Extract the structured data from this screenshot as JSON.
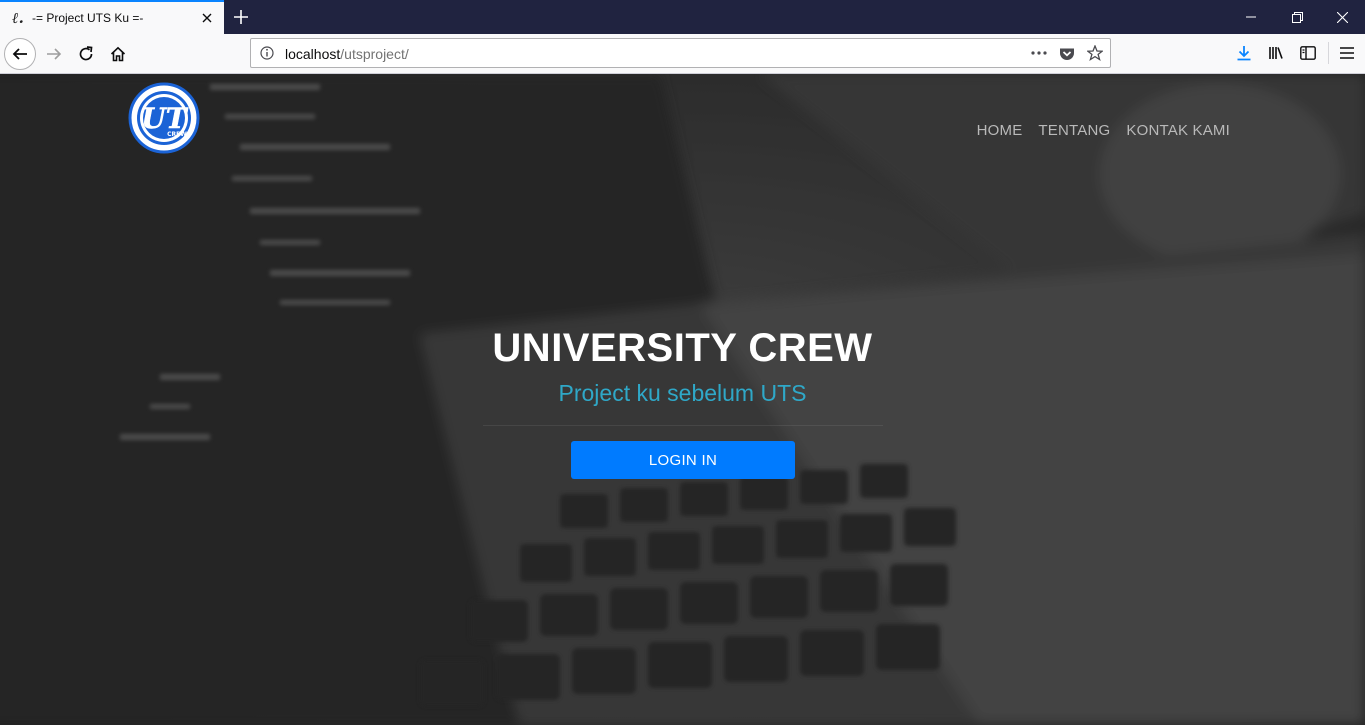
{
  "browser": {
    "tab": {
      "title": "-= Project UTS Ku =-",
      "favicon_glyph": "ℓ."
    },
    "url": {
      "host": "localhost",
      "path": "/utsproject/"
    },
    "icons": {
      "tab_close": "close-icon",
      "new_tab": "plus-icon",
      "minimize": "minimize-icon",
      "restore": "restore-icon",
      "close_window": "close-icon",
      "back": "arrow-left-icon",
      "forward": "arrow-right-icon",
      "reload": "reload-icon",
      "home": "home-icon",
      "site_info": "info-icon",
      "page_actions": "more-horizontal-icon",
      "pocket": "pocket-icon",
      "bookmark": "star-icon",
      "downloads": "download-icon",
      "library": "library-icon",
      "sidebar": "sidebar-icon",
      "menu": "hamburger-icon"
    },
    "colors": {
      "accent": "#0a84ff",
      "titlebar": "#202340"
    }
  },
  "site": {
    "logo": {
      "text": "UT",
      "ring_text": "CREW"
    },
    "nav": {
      "home": "HOME",
      "about": "TENTANG",
      "contact": "KONTAK KAMI"
    },
    "hero": {
      "title": "UNIVERSITY CREW",
      "subtitle": "Project ku sebelum UTS",
      "button": "LOGIN IN"
    },
    "colors": {
      "button": "#007bff",
      "subtitle": "#2fa8c8"
    }
  }
}
